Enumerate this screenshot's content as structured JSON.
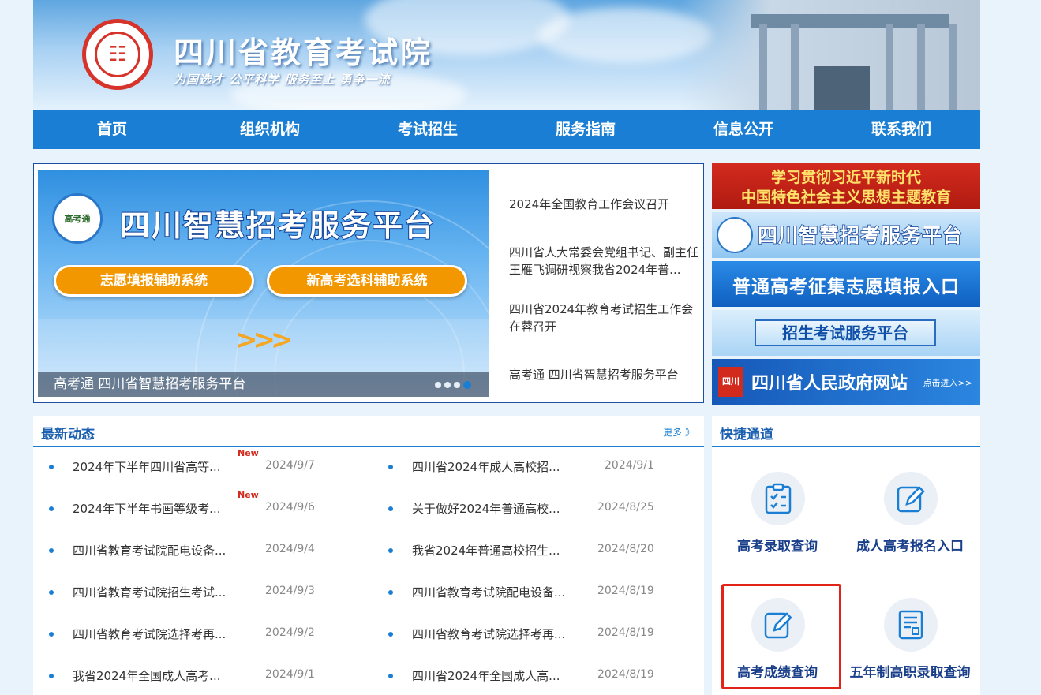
{
  "header": {
    "site_title": "四川省教育考试院",
    "slogan": "为国选才  公平科学  服务至上  勇争一流"
  },
  "nav": [
    {
      "label": "首页"
    },
    {
      "label": "组织机构"
    },
    {
      "label": "考试招生"
    },
    {
      "label": "服务指南"
    },
    {
      "label": "信息公开"
    },
    {
      "label": "联系我们"
    }
  ],
  "slider": {
    "logo_text": "高考通",
    "title": "四川智慧招考服务平台",
    "buttons": [
      "志愿填报辅助系统",
      "新高考选科辅助系统"
    ],
    "caption": "高考通 四川省智慧招考服务平台"
  },
  "focus_news": [
    "2024年全国教育工作会议召开",
    "四川省人大常委会党组书记、副主任王雁飞调研视察我省2024年普...",
    "四川省2024年教育考试招生工作会在蓉召开",
    "高考通 四川省智慧招考服务平台"
  ],
  "banners": {
    "b1_line1": "学习贯彻习近平新时代",
    "b1_line2": "中国特色社会主义思想主题教育",
    "b2": "四川智慧招考服务平台",
    "b3": "普通高考征集志愿填报入口",
    "b4": "招生考试服务平台",
    "b5": "四川省人民政府网站",
    "b5_sub": "点击进入>>"
  },
  "latest": {
    "title": "最新动态",
    "more": "更多 》",
    "new_tag": "New",
    "left": [
      {
        "title": "2024年下半年四川省高等...",
        "date": "2024/9/7",
        "new": true
      },
      {
        "title": "2024年下半年书画等级考...",
        "date": "2024/9/6",
        "new": true
      },
      {
        "title": "四川省教育考试院配电设备...",
        "date": "2024/9/4",
        "new": false
      },
      {
        "title": "四川省教育考试院招生考试...",
        "date": "2024/9/3",
        "new": false
      },
      {
        "title": "四川省教育考试院选择考再...",
        "date": "2024/9/2",
        "new": false
      },
      {
        "title": "我省2024年全国成人高考...",
        "date": "2024/9/1",
        "new": false
      }
    ],
    "right": [
      {
        "title": "四川省2024年成人高校招...",
        "date": "2024/9/1"
      },
      {
        "title": "关于做好2024年普通高校...",
        "date": "2024/8/25"
      },
      {
        "title": "我省2024年普通高校招生...",
        "date": "2024/8/20"
      },
      {
        "title": "四川省教育考试院配电设备...",
        "date": "2024/8/19"
      },
      {
        "title": "四川省教育考试院选择考再...",
        "date": "2024/8/19"
      },
      {
        "title": "四川省2024年全国成人高...",
        "date": "2024/8/19"
      }
    ]
  },
  "quick": {
    "title": "快捷通道",
    "items": [
      {
        "label": "高考录取查询",
        "icon": "checklist-icon"
      },
      {
        "label": "成人高考报名入口",
        "icon": "edit-icon"
      },
      {
        "label": "高考成绩查询",
        "icon": "edit-icon"
      },
      {
        "label": "五年制高职录取查询",
        "icon": "document-icon"
      }
    ]
  },
  "colors": {
    "nav_blue": "#1a7fd4",
    "highlight_red": "#e2231a",
    "accent_orange": "#f39700"
  }
}
